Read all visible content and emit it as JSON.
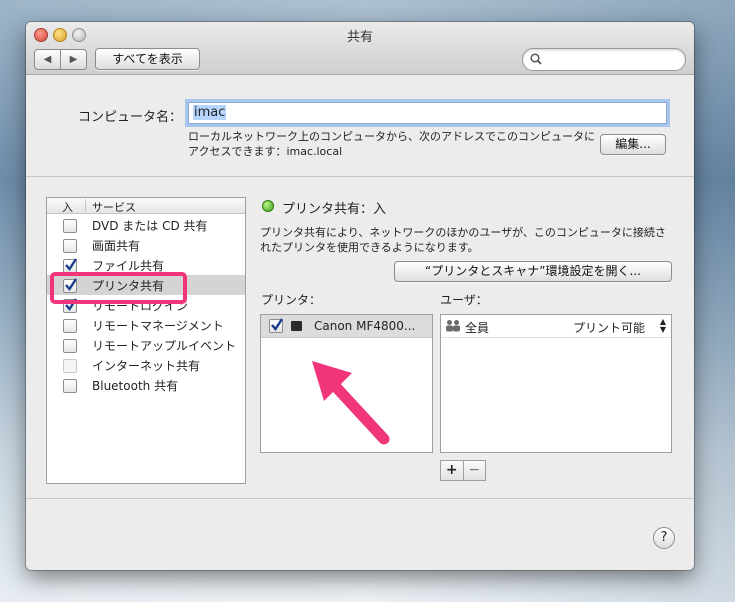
{
  "window": {
    "title": "共有",
    "nav_back": "◀",
    "nav_forward": "▶",
    "show_all_label": "すべてを表示",
    "search_icon": "magnifier"
  },
  "computer": {
    "name_label": "コンピュータ名：",
    "name_value": "imac",
    "address_line1": "ローカルネットワーク上のコンピュータから、次のアドレスでこのコンピュータに",
    "address_line2": "アクセスできます：imac.local",
    "edit_label": "編集..."
  },
  "services": {
    "header_on": "入",
    "header_service": "サービス",
    "items": [
      {
        "label": "DVD または CD 共有",
        "checked": false,
        "enabled": true
      },
      {
        "label": "画面共有",
        "checked": false,
        "enabled": true
      },
      {
        "label": "ファイル共有",
        "checked": true,
        "enabled": true
      },
      {
        "label": "プリンタ共有",
        "checked": true,
        "enabled": true,
        "selected": true
      },
      {
        "label": "リモートログイン",
        "checked": true,
        "enabled": true
      },
      {
        "label": "リモートマネージメント",
        "checked": false,
        "enabled": true
      },
      {
        "label": "リモートアップルイベント",
        "checked": false,
        "enabled": true
      },
      {
        "label": "インターネット共有",
        "checked": false,
        "enabled": false
      },
      {
        "label": "Bluetooth 共有",
        "checked": false,
        "enabled": true
      }
    ]
  },
  "detail": {
    "status": "プリンタ共有：入",
    "status_color": "#3a9d15",
    "description_line1": "プリンタ共有により、ネットワークのほかのユーザが、このコンピュータに接続さ",
    "description_line2": "れたプリンタを使用できるようになります。",
    "open_prefs_label": "“プリンタとスキャナ”環境設定を開く...",
    "printers_header": "プリンタ：",
    "users_header": "ユーザ：",
    "printers": [
      {
        "name": "Canon MF4800...",
        "checked": true
      }
    ],
    "users": [
      {
        "name": "全員",
        "permission": "プリント可能"
      }
    ],
    "add_label": "+",
    "remove_label": "−"
  },
  "help_label": "?",
  "annotation_color": "#f0357a"
}
